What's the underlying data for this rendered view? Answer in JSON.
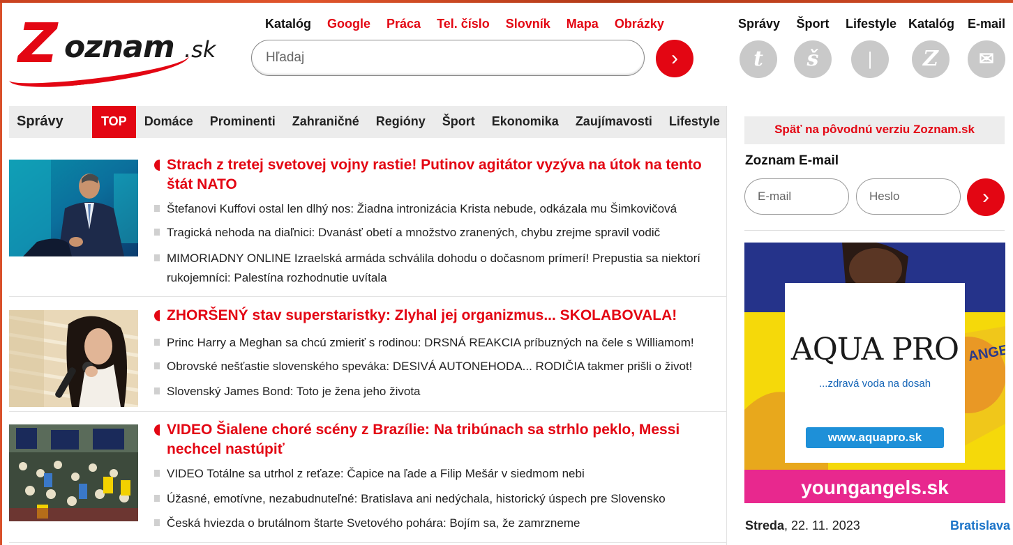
{
  "logo": {
    "brand": "Zoznam",
    "brand_initial": "Z",
    "brand_rest": "oznam",
    "tld": ".sk"
  },
  "topnav": [
    {
      "label": "Katalóg",
      "style": "dark"
    },
    {
      "label": "Google",
      "style": "red"
    },
    {
      "label": "Práca",
      "style": "red"
    },
    {
      "label": "Tel. číslo",
      "style": "red"
    },
    {
      "label": "Slovník",
      "style": "red"
    },
    {
      "label": "Mapa",
      "style": "red"
    },
    {
      "label": "Obrázky",
      "style": "red"
    }
  ],
  "search": {
    "placeholder": "Hľadaj",
    "button_icon": "chevron-right-icon",
    "button_glyph": "›"
  },
  "services": [
    {
      "label": "Správy",
      "glyph": "t",
      "icon": "spravy-icon"
    },
    {
      "label": "Šport",
      "glyph": "š",
      "icon": "sport-icon"
    },
    {
      "label": "Lifestyle",
      "glyph": "|",
      "icon": "lifestyle-icon"
    },
    {
      "label": "Katalóg",
      "glyph": "Z",
      "icon": "katalog-icon"
    },
    {
      "label": "E-mail",
      "glyph": "✉",
      "icon": "envelope-icon"
    }
  ],
  "section_nav": {
    "label": "Správy",
    "tabs": [
      "TOP",
      "Domáce",
      "Prominenti",
      "Zahraničné",
      "Regióny",
      "Šport",
      "Ekonomika",
      "Zaujímavosti",
      "Lifestyle"
    ],
    "active": "TOP"
  },
  "articles": [
    {
      "headline": "Strach z tretej svetovej vojny rastie! Putinov agitátor vyzýva na útok na tento štát NATO",
      "related": [
        "Štefanovi Kuffovi ostal len dlhý nos: Žiadna intronizácia Krista nebude, odkázala mu Šimkovičová",
        "Tragická nehoda na diaľnici: Dvanásť obetí a množstvo zranených, chybu zrejme spravil vodič",
        "MIMORIADNY ONLINE Izraelská armáda schválila dohodu o dočasnom prímerí! Prepustia sa niektorí rukojemníci: Palestína rozhodnutie uvítala"
      ]
    },
    {
      "headline": "ZHORŠENÝ stav superstaristky: Zlyhal jej organizmus... SKOLABOVALA!",
      "related": [
        "Princ Harry a Meghan sa chcú zmieriť s rodinou: DRSNÁ REAKCIA príbuzných na čele s Williamom!",
        "Obrovské nešťastie slovenského speváka: DESIVÁ AUTONEHODA... RODIČIA takmer prišli o život!",
        "Slovenský James Bond: Toto je žena jeho života"
      ]
    },
    {
      "headline": "VIDEO Šialene choré scény z Brazílie: Na tribúnach sa strhlo peklo, Messi nechcel nastúpiť",
      "related": [
        "VIDEO Totálne sa utrhol z reťaze: Čapice na ľade a Filip Mešár v siedmom nebi",
        "Úžasné, emotívne, nezabudnuteľné: Bratislava ani nedýchala, historický úspech pre Slovensko",
        "Česká hviezda o brutálnom štarte Svetového pohára: Bojím sa, že zamrzneme"
      ]
    }
  ],
  "sidebar": {
    "back_link": "Späť na pôvodnú verziu Zoznam.sk",
    "email_title": "Zoznam E-mail",
    "email_placeholder": "E-mail",
    "password_placeholder": "Heslo",
    "ad": {
      "brand": "AQUA PRO",
      "tagline": "...zdravá voda na dosah",
      "url": "www.aquapro.sk",
      "footer": "youngangels.sk",
      "side_text": "ANGELS"
    },
    "date_day": "Streda",
    "date_value": ", 22. 11. 2023",
    "city": "Bratislava"
  },
  "colors": {
    "accent": "#e30613",
    "link_blue": "#1a73c8",
    "nav_bg": "#ececec",
    "icon_grey": "#c9c9c9"
  }
}
